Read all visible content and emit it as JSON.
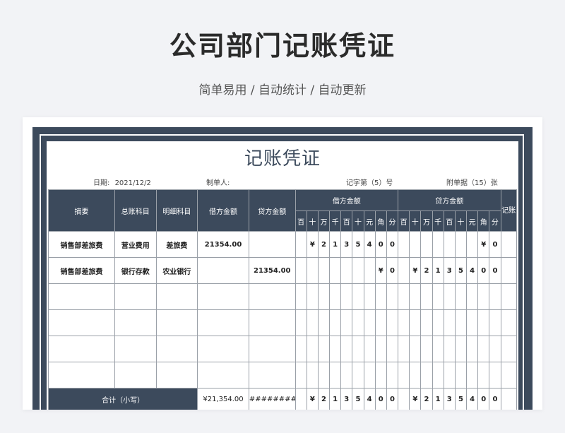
{
  "page": {
    "title": "公司部门记账凭证",
    "subtitle": "简单易用 / 自动统计 / 自动更新"
  },
  "voucher": {
    "title": "记账凭证",
    "date_label": "日期:",
    "date_value": "2021/12/2",
    "preparer_label": "制单人:",
    "voucher_no": "记字第（5）号",
    "attachments": "附单据（15）张",
    "headers": {
      "summary": "摘要",
      "general_account": "总账科目",
      "detail_account": "明细科目",
      "debit_amount": "借方金额",
      "credit_amount": "贷方金额",
      "debit_group": "借方金额",
      "credit_group": "贷方金额",
      "posted": "记账",
      "digit_units": [
        "百",
        "十",
        "万",
        "千",
        "百",
        "十",
        "元",
        "角",
        "分"
      ]
    },
    "rows": [
      {
        "summary": "销售部差旅费",
        "general_account": "营业费用",
        "detail_account": "差旅费",
        "debit": "21354.00",
        "credit": "",
        "debit_digits": [
          "",
          "",
          "¥",
          "2",
          "1",
          "3",
          "5",
          "4",
          "0",
          "0"
        ],
        "credit_digits": [
          "",
          "",
          "",
          "",
          "",
          "",
          "",
          "",
          "¥",
          "0"
        ],
        "posted": ""
      },
      {
        "summary": "销售部差旅费",
        "general_account": "银行存款",
        "detail_account": "农业银行",
        "debit": "",
        "credit": "21354.00",
        "debit_digits": [
          "",
          "",
          "",
          "",
          "",
          "",
          "",
          "",
          "¥",
          "0"
        ],
        "credit_digits": [
          "",
          "",
          "¥",
          "2",
          "1",
          "3",
          "5",
          "4",
          "0",
          "0"
        ],
        "posted": ""
      }
    ],
    "empty_rows": 4,
    "total": {
      "label": "合计（小写）",
      "debit": "¥21,354.00",
      "credit": "#########",
      "debit_digits": [
        "",
        "",
        "¥",
        "2",
        "1",
        "3",
        "5",
        "4",
        "0",
        "0"
      ],
      "credit_digits": [
        "",
        "",
        "¥",
        "2",
        "1",
        "3",
        "5",
        "4",
        "0",
        "0"
      ]
    }
  },
  "colors": {
    "header_bg": "#3c4a5c",
    "grid": "#9aa0a8",
    "page_bg": "#f2f3f6"
  }
}
